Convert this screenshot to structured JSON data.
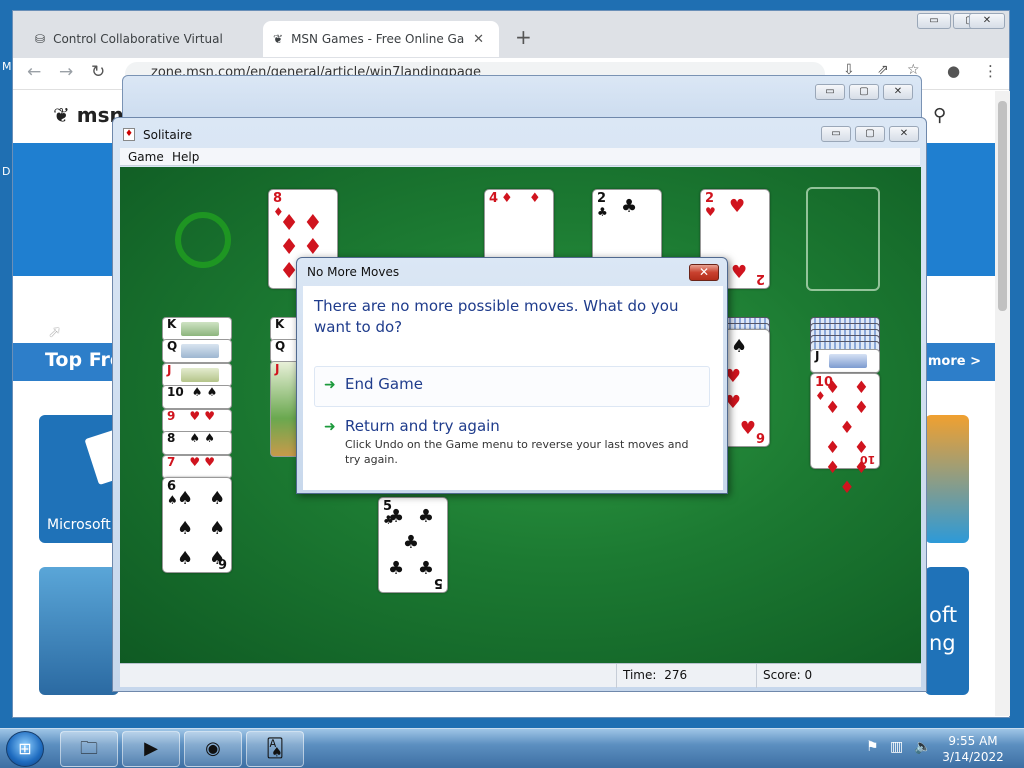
{
  "browser": {
    "tabs": [
      {
        "title": "Control Collaborative Virtual Ma",
        "icon": "vm-icon",
        "active": false
      },
      {
        "title": "MSN Games - Free Online Games",
        "icon": "msn-butterfly-icon",
        "active": true
      }
    ],
    "new_tab": "+",
    "url": "zone.msn.com/en/general/article/win7landingpage",
    "window_controls": {
      "minimize": "▭",
      "maximize": "▢",
      "close": "✕"
    }
  },
  "msn_page": {
    "logo": "msn",
    "section_title": "Top Fre",
    "more_link": "more >",
    "tile_microsoft": "Microsoft",
    "tile_right_text_1": "oft",
    "tile_right_text_2": "ng"
  },
  "desktop": {
    "side_letters": [
      "M",
      "D"
    ]
  },
  "solitaire": {
    "title": "Solitaire",
    "menu": [
      "Game",
      "Help"
    ],
    "status": {
      "time_label": "Time:",
      "time_value": "276",
      "score_label": "Score:",
      "score_value": "0"
    },
    "waste_card": {
      "rank": "8",
      "suit": "♦"
    },
    "foundations": [
      {
        "rank": "4",
        "suit": "♦"
      },
      {
        "rank": "2",
        "suit": "♣"
      },
      {
        "rank": "2",
        "suit": "♥"
      }
    ],
    "tableau_col1": [
      {
        "rank": "K",
        "suit": "♣"
      },
      {
        "rank": "Q",
        "suit": "♥"
      },
      {
        "rank": "J",
        "suit": "♣"
      },
      {
        "rank": "10",
        "suit": "♠"
      },
      {
        "rank": "9",
        "suit": "♥"
      },
      {
        "rank": "8",
        "suit": "♠"
      },
      {
        "rank": "7",
        "suit": "♥"
      },
      {
        "rank": "6",
        "suit": "♠"
      }
    ],
    "tableau_col2": [
      {
        "rank": "K",
        "suit": "♠"
      },
      {
        "rank": "Q",
        "suit": "♥"
      },
      {
        "rank": "J",
        "suit": "♥"
      }
    ],
    "tableau_five": {
      "rank": "5",
      "suit": "♣"
    },
    "tableau_hearts": {
      "rank": "6",
      "suit": "♥"
    },
    "tableau_last": [
      {
        "rank": "J",
        "suit": "♠"
      },
      {
        "rank": "10",
        "suit": "♦"
      }
    ]
  },
  "dialog": {
    "title": "No More Moves",
    "message": "There are no more possible moves. What do you want to do?",
    "option1": "End Game",
    "option2": "Return and try again",
    "option2_desc": "Click Undo on the Game menu to reverse your last moves and try again."
  },
  "taskbar": {
    "start_icon": "windows-orb-icon",
    "items": [
      "file-explorer-icon",
      "media-player-icon",
      "chrome-icon",
      "solitaire-icon"
    ],
    "time": "9:55 AM",
    "date": "3/14/2022"
  },
  "colors": {
    "felt": "#1c7a32",
    "dialog_text": "#1f3c8c",
    "taskbar": "#3d6fa3"
  }
}
